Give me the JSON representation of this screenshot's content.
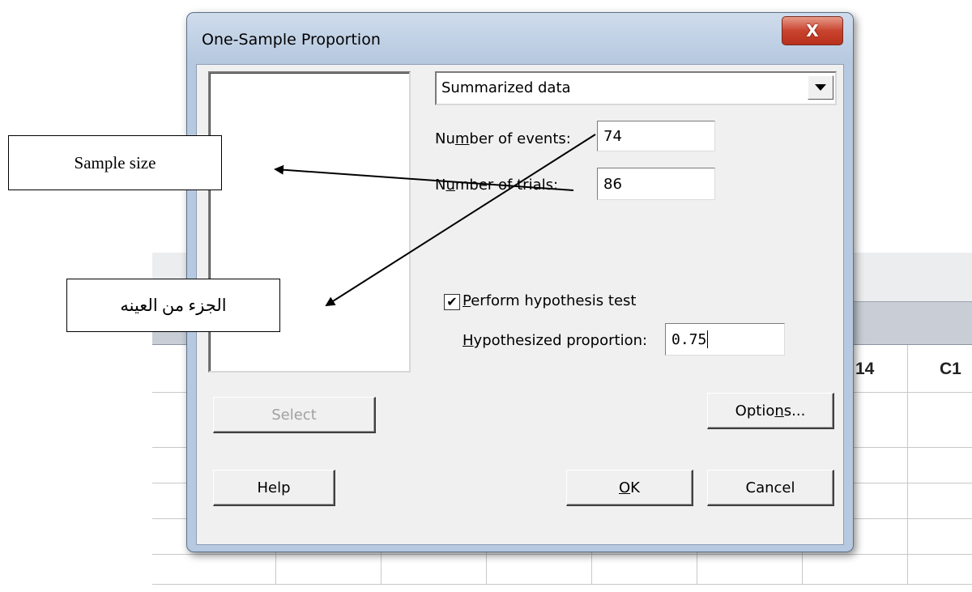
{
  "worksheet": {
    "column_headers": [
      "14",
      "C1"
    ]
  },
  "dialog": {
    "title": "One-Sample Proportion",
    "close_label": "X",
    "data_mode": "Summarized data",
    "events": {
      "label_pre": "Nu",
      "label_acc": "m",
      "label_post": "ber of events:",
      "value": "74"
    },
    "trials": {
      "label_pre": "N",
      "label_acc": "u",
      "label_post": "mber of trials:",
      "value": "86"
    },
    "perform_test": {
      "checked": true,
      "check_glyph": "✔",
      "label_acc": "P",
      "label_post": "erform hypothesis test"
    },
    "hypothesized": {
      "label_acc": "H",
      "label_post": "ypothesized proportion:",
      "value": "0.75"
    },
    "buttons": {
      "select": "Select",
      "options_pre": "Optio",
      "options_acc": "n",
      "options_post": "s...",
      "help": "Help",
      "ok_acc": "O",
      "ok_post": "K",
      "cancel": "Cancel"
    }
  },
  "annotations": {
    "sample_size": "Sample size",
    "sample_part": "الجزء من العينه"
  }
}
